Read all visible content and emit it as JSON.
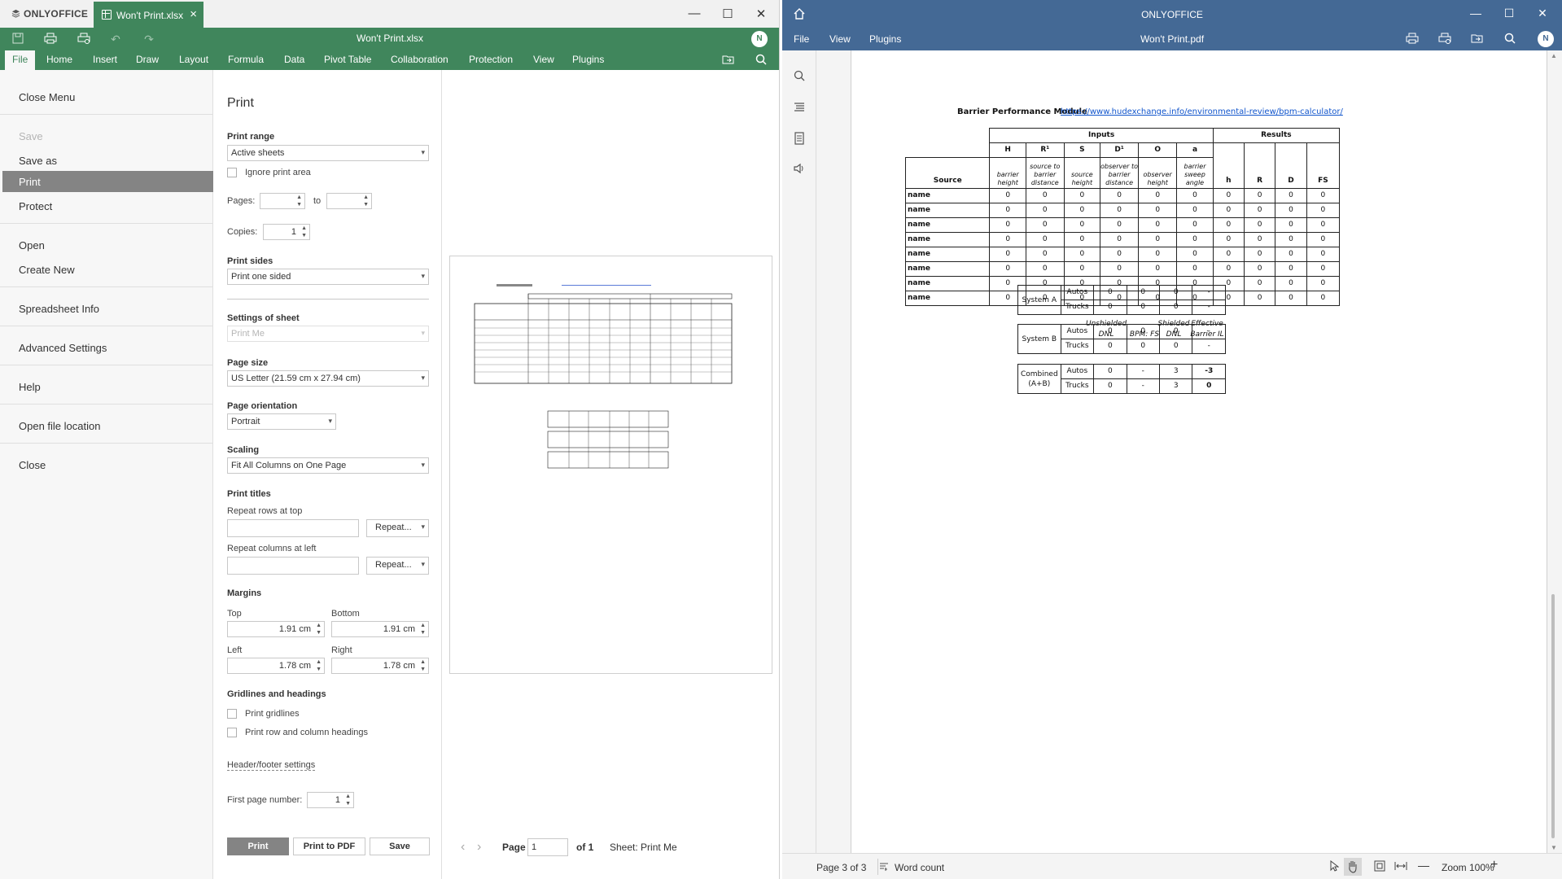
{
  "left_window": {
    "brand": "ONLYOFFICE",
    "tab_title": "Won't Print.xlsx",
    "doc_title": "Won't Print.xlsx",
    "avatar": "N",
    "menu_tabs": [
      "File",
      "Home",
      "Insert",
      "Draw",
      "Layout",
      "Formula",
      "Data",
      "Pivot Table",
      "Collaboration",
      "Protection",
      "View",
      "Plugins"
    ],
    "file_menu": {
      "close_menu": "Close Menu",
      "save": "Save",
      "save_as": "Save as",
      "print": "Print",
      "protect": "Protect",
      "open": "Open",
      "create_new": "Create New",
      "spreadsheet_info": "Spreadsheet Info",
      "advanced_settings": "Advanced Settings",
      "help": "Help",
      "open_file_location": "Open file location",
      "close": "Close"
    },
    "print_panel": {
      "title": "Print",
      "print_range_label": "Print range",
      "print_range_value": "Active sheets",
      "ignore_print_area": "Ignore print area",
      "pages_label": "Pages:",
      "pages_to": "to",
      "copies_label": "Copies:",
      "copies_value": "1",
      "print_sides_label": "Print sides",
      "print_sides_value": "Print one sided",
      "settings_of_sheet_label": "Settings of sheet",
      "sheet_value": "Print Me",
      "page_size_label": "Page size",
      "page_size_value": "US Letter (21.59 cm x 27.94 cm)",
      "page_orientation_label": "Page orientation",
      "page_orientation_value": "Portrait",
      "scaling_label": "Scaling",
      "scaling_value": "Fit All Columns on One Page",
      "print_titles_label": "Print titles",
      "repeat_rows_label": "Repeat rows at top",
      "repeat_cols_label": "Repeat columns at left",
      "repeat_button": "Repeat...",
      "margins_label": "Margins",
      "top_label": "Top",
      "top_value": "1.91 cm",
      "bottom_label": "Bottom",
      "bottom_value": "1.91 cm",
      "left_label": "Left",
      "left_value": "1.78 cm",
      "right_label": "Right",
      "right_value": "1.78 cm",
      "gridlines_label": "Gridlines and headings",
      "print_gridlines": "Print gridlines",
      "print_row_col_headings": "Print row and column headings",
      "header_footer_link": "Header/footer settings",
      "first_page_number_label": "First page number:",
      "first_page_number_value": "1",
      "btn_print": "Print",
      "btn_print_pdf": "Print to PDF",
      "btn_save": "Save"
    },
    "preview": {
      "page_label": "Page",
      "page_value": "1",
      "of_label": "of 1",
      "sheet_label": "Sheet: Print Me"
    }
  },
  "right_window": {
    "app_title": "ONLYOFFICE",
    "doc_name": "Won't Print.pdf",
    "menus": [
      "File",
      "View",
      "Plugins"
    ],
    "avatar": "N",
    "status": {
      "page_indicator": "Page 3 of 3",
      "word_count": "Word count",
      "zoom": "Zoom 100%"
    }
  },
  "pdf_page": {
    "module_title": "Barrier Performance Module",
    "module_link": "https://www.hudexchange.info/environmental-review/bpm-calculator/",
    "group_inputs": "Inputs",
    "group_results": "Results",
    "col_codes": [
      "H",
      "R¹",
      "S",
      "D¹",
      "O",
      "a"
    ],
    "col_desc": [
      "barrier height",
      "source to barrier distance",
      "source height",
      "observer to barrier distance",
      "observer height",
      "barrier sweep angle"
    ],
    "source_header": "Source",
    "result_codes": [
      "h",
      "R",
      "D",
      "FS"
    ],
    "rows": [
      {
        "name": "name",
        "values": [
          "0",
          "0",
          "0",
          "0",
          "0",
          "0",
          "0",
          "0",
          "0",
          "0"
        ]
      },
      {
        "name": "name",
        "values": [
          "0",
          "0",
          "0",
          "0",
          "0",
          "0",
          "0",
          "0",
          "0",
          "0"
        ]
      },
      {
        "name": "name",
        "values": [
          "0",
          "0",
          "0",
          "0",
          "0",
          "0",
          "0",
          "0",
          "0",
          "0"
        ]
      },
      {
        "name": "name",
        "values": [
          "0",
          "0",
          "0",
          "0",
          "0",
          "0",
          "0",
          "0",
          "0",
          "0"
        ]
      },
      {
        "name": "name",
        "values": [
          "0",
          "0",
          "0",
          "0",
          "0",
          "0",
          "0",
          "0",
          "0",
          "0"
        ]
      },
      {
        "name": "name",
        "values": [
          "0",
          "0",
          "0",
          "0",
          "0",
          "0",
          "0",
          "0",
          "0",
          "0"
        ]
      },
      {
        "name": "name",
        "values": [
          "0",
          "0",
          "0",
          "0",
          "0",
          "0",
          "0",
          "0",
          "0",
          "0"
        ]
      },
      {
        "name": "name",
        "values": [
          "0",
          "0",
          "0",
          "0",
          "0",
          "0",
          "0",
          "0",
          "0",
          "0"
        ]
      }
    ],
    "summary_headers": [
      "Unshielded DNL",
      "BPM: FS",
      "Shielded DNL",
      "Effective Barrier IL"
    ],
    "systems": [
      {
        "label": "System A",
        "rows": [
          [
            "Autos",
            "0",
            "0",
            "0",
            "-"
          ],
          [
            "Trucks",
            "0",
            "0",
            "0",
            "-"
          ]
        ]
      },
      {
        "label": "System B",
        "rows": [
          [
            "Autos",
            "0",
            "0",
            "0",
            "-"
          ],
          [
            "Trucks",
            "0",
            "0",
            "0",
            "-"
          ]
        ]
      },
      {
        "label": "Combined (A+B)",
        "rows": [
          [
            "Autos",
            "0",
            "-",
            "3",
            "-3"
          ],
          [
            "Trucks",
            "0",
            "-",
            "3",
            "0"
          ]
        ]
      }
    ]
  },
  "colors": {
    "sheet_green": "#40865c",
    "pdf_blue": "#446995",
    "selected_gray": "#848484",
    "link_blue": "#1155cc"
  },
  "icons": [
    "save-icon",
    "print-icon",
    "quick-print-icon",
    "undo-icon",
    "redo-icon",
    "open-location-icon",
    "search-icon",
    "home-icon",
    "comments-icon",
    "navigation-icon",
    "thumbnails-icon",
    "speech-icon",
    "select-tool-icon",
    "hand-tool-icon",
    "fit-page-icon",
    "fit-width-icon",
    "zoom-out-icon",
    "zoom-in-icon"
  ]
}
